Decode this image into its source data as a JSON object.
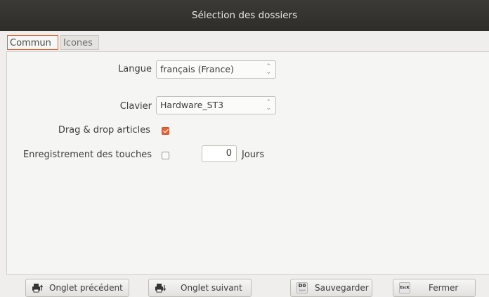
{
  "window": {
    "title": "Sélection des dossiers"
  },
  "tabs": [
    {
      "label": "Commun",
      "active": true
    },
    {
      "label": "Icones",
      "active": false
    }
  ],
  "form": {
    "langue": {
      "label": "Langue",
      "value": "français (France)"
    },
    "clavier": {
      "label": "Clavier",
      "value": "Hardware_ST3"
    },
    "drag_drop": {
      "label": "Drag & drop articles",
      "checked": true
    },
    "enregistrement": {
      "label": "Enregistrement des touches",
      "checked": false,
      "value": "0",
      "unit": "Jours"
    }
  },
  "buttons": {
    "prev": {
      "label": "Onglet précédent",
      "icon": "printer-up-icon"
    },
    "next": {
      "label": "Onglet suivant",
      "icon": "printer-down-icon"
    },
    "save": {
      "label": "Sauvegarder",
      "icon": "key-d0-icon",
      "key": "D0",
      "key_sub": "Save"
    },
    "close": {
      "label": "Fermer",
      "icon": "key-esc-icon",
      "key": "EscK"
    }
  },
  "colors": {
    "accent": "#e0643a",
    "titlebar": "#33322f"
  }
}
